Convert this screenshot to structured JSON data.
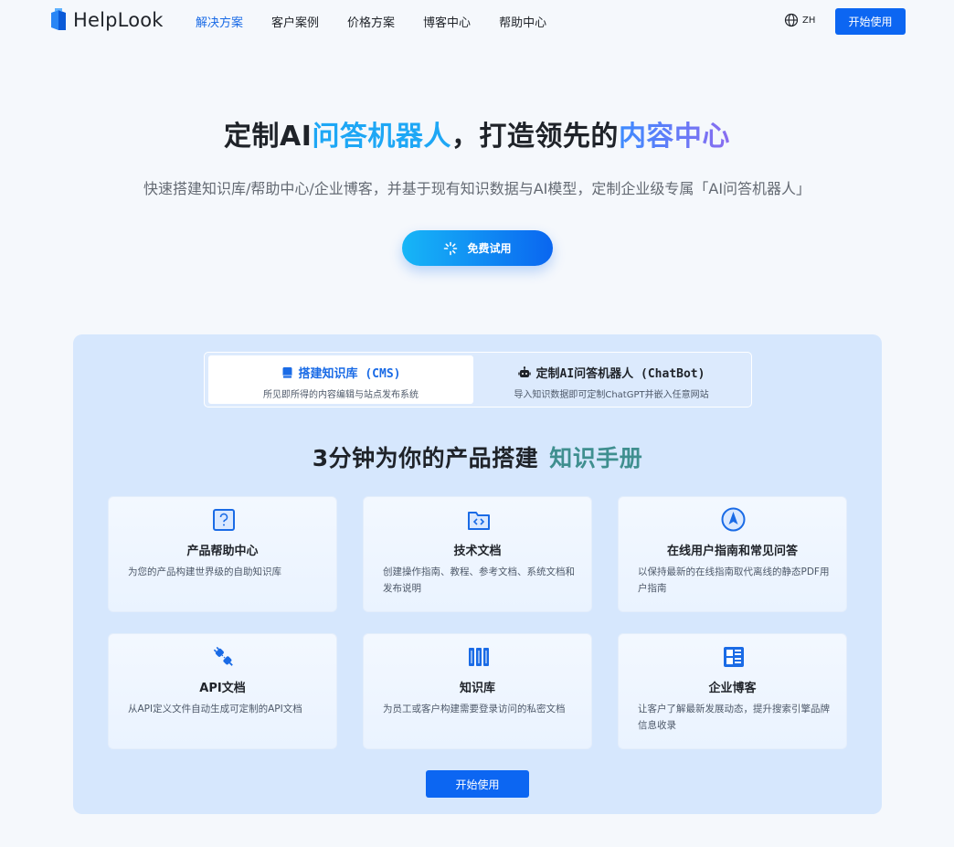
{
  "header": {
    "logo_text": "HelpLook",
    "nav": [
      {
        "label": "解决方案",
        "active": true
      },
      {
        "label": "客户案例",
        "active": false
      },
      {
        "label": "价格方案",
        "active": false
      },
      {
        "label": "博客中心",
        "active": false
      },
      {
        "label": "帮助中心",
        "active": false
      }
    ],
    "lang_label": "ZH",
    "cta_label": "开始使用"
  },
  "hero": {
    "title_part1": "定制AI",
    "title_hl1": "问答机器人",
    "title_part2": "，打造领先的",
    "title_hl2": "内容中心",
    "subtitle": "快速搭建知识库/帮助中心/企业博客，并基于现有知识数据与AI模型，定制企业级专属「AI问答机器人」",
    "trial_label": "免费试用"
  },
  "panel": {
    "tabs": [
      {
        "title": "搭建知识库 (CMS)",
        "sub": "所见即所得的内容编辑与站点发布系统",
        "icon": "book-icon",
        "active": true
      },
      {
        "title": "定制AI问答机器人 (ChatBot)",
        "sub": "导入知识数据即可定制ChatGPT并嵌入任意网站",
        "icon": "robot-icon",
        "active": false
      }
    ],
    "title": "3分钟为你的产品搭建",
    "title_hl": "知识手册",
    "cards": [
      {
        "icon": "question-icon",
        "title": "产品帮助中心",
        "desc": "为您的产品构建世界级的自助知识库"
      },
      {
        "icon": "code-folder-icon",
        "title": "技术文档",
        "desc": "创建操作指南、教程、参考文档、系统文档和发布说明"
      },
      {
        "icon": "compass-icon",
        "title": "在线用户指南和常见问答",
        "desc": "以保持最新的在线指南取代离线的静态PDF用户指南"
      },
      {
        "icon": "plug-icon",
        "title": "API文档",
        "desc": "从API定义文件自动生成可定制的API文档"
      },
      {
        "icon": "library-icon",
        "title": "知识库",
        "desc": "为员工或客户构建需要登录访问的私密文档"
      },
      {
        "icon": "blog-layout-icon",
        "title": "企业博客",
        "desc": "让客户了解最新发展动态，提升搜索引擎品牌信息收录"
      }
    ],
    "cta_label": "开始使用"
  },
  "colors": {
    "primary": "#0c66f2",
    "nav_active": "#1a6be6",
    "hero_hl1": "#1ea7f5",
    "panel_bg": "#d6e7fd",
    "panel_title_hl": "#3f8f8f"
  }
}
